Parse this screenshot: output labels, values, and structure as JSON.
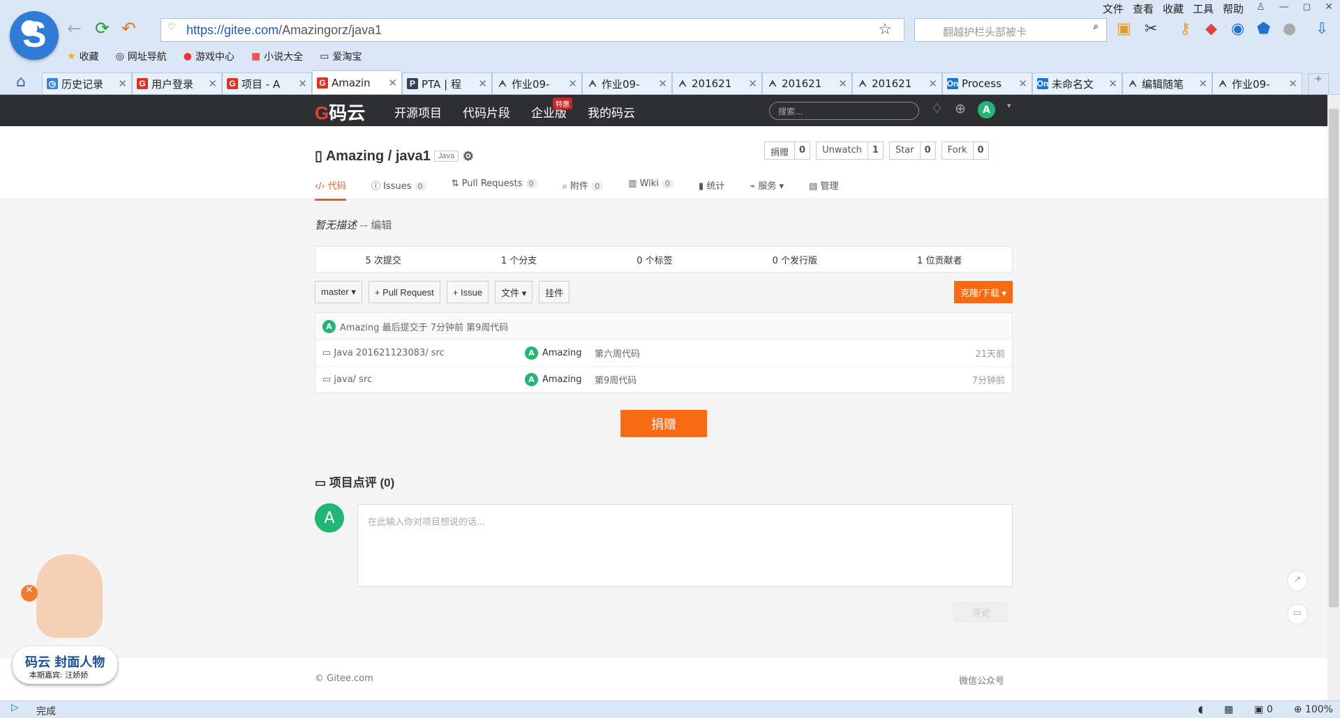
{
  "browser": {
    "menu": [
      "文件",
      "查看",
      "收藏",
      "工具",
      "帮助"
    ],
    "url_prefix": "https://",
    "url_host": "gitee.com",
    "url_path": "/Amazingorz/java1",
    "search_placeholder": "翻越护栏头部被卡",
    "bookmarks": [
      "收藏",
      "网址导航",
      "游戏中心",
      "小说大全",
      "爱淘宝"
    ],
    "tabs": [
      {
        "label": "历史记录",
        "icon": "clock-icon"
      },
      {
        "label": "用户登录",
        "icon": "gitee-icon"
      },
      {
        "label": "项目 - A",
        "icon": "gitee-icon"
      },
      {
        "label": "Amazin",
        "icon": "gitee-icon",
        "active": true
      },
      {
        "label": "PTA | 程",
        "icon": "pta-icon"
      },
      {
        "label": "作业09-",
        "icon": "blog-icon"
      },
      {
        "label": "作业09-",
        "icon": "blog-icon"
      },
      {
        "label": "201621",
        "icon": "blog-icon"
      },
      {
        "label": "201621",
        "icon": "blog-icon"
      },
      {
        "label": "201621",
        "icon": "blog-icon"
      },
      {
        "label": "Process",
        "icon": "on-icon"
      },
      {
        "label": "未命名文",
        "icon": "on-icon"
      },
      {
        "label": "编辑随笔",
        "icon": "blog-icon"
      },
      {
        "label": "作业09-",
        "icon": "blog-icon"
      }
    ]
  },
  "gitee": {
    "brand": "码云",
    "nav": [
      "开源项目",
      "代码片段",
      "企业版",
      "我的码云"
    ],
    "badge": "特惠",
    "search": "搜索...",
    "avatar": "A"
  },
  "repo": {
    "owner": "Amazing",
    "name": "java1",
    "language": "Java",
    "actions": [
      {
        "label": "捐赠",
        "count": "0"
      },
      {
        "label": "Unwatch",
        "count": "1"
      },
      {
        "label": "Star",
        "count": "0"
      },
      {
        "label": "Fork",
        "count": "0"
      }
    ],
    "tabs": [
      {
        "label": "代码",
        "count": ""
      },
      {
        "label": "Issues",
        "count": "0"
      },
      {
        "label": "Pull Requests",
        "count": "0"
      },
      {
        "label": "附件",
        "count": "0"
      },
      {
        "label": "Wiki",
        "count": "0"
      },
      {
        "label": "统计",
        "count": ""
      },
      {
        "label": "服务",
        "count": ""
      },
      {
        "label": "管理",
        "count": ""
      }
    ],
    "description": "暂无描述",
    "edit": "-- 编辑",
    "stats": [
      "5 次提交",
      "1 个分支",
      "0 个标签",
      "0 个发行版",
      "1 位贡献者"
    ],
    "branch": "master ▾",
    "buttons": [
      "+ Pull Request",
      "+ Issue",
      "文件 ▾",
      "挂件"
    ],
    "clone": "克隆/下载 ▾",
    "last_commit": "Amazing 最后提交于 7分钟前 第9周代码",
    "files": [
      {
        "name": "Java 201621123083/ src",
        "author": "Amazing",
        "message": "第六周代码",
        "time": "21天前"
      },
      {
        "name": "java/ src",
        "author": "Amazing",
        "message": "第9周代码",
        "time": "7分钟前"
      }
    ],
    "donate": "捐赠",
    "comments_title": "项目点评 (0)",
    "comment_placeholder": "在此输入你对项目想说的话...",
    "submit": "评论"
  },
  "footer": {
    "copyright": "© Gitee.com",
    "wechat": "微信公众号"
  },
  "promo": {
    "title": "码云 封面人物",
    "guest": "本期嘉宾: 汪娇娇"
  },
  "status": {
    "left": "完成",
    "zoom": "100%",
    "count": "0"
  }
}
